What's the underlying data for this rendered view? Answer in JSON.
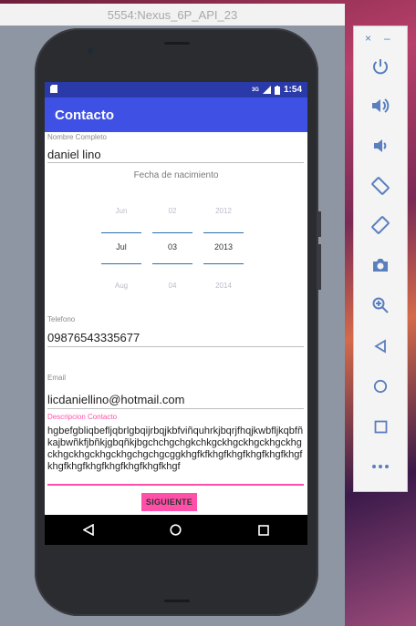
{
  "emulator": {
    "title": "5554:Nexus_6P_API_23"
  },
  "statusbar": {
    "signal": "3G",
    "time": "1:54"
  },
  "appbar": {
    "title": "Contacto"
  },
  "form": {
    "name_label": "Nombre Completo",
    "name_value": "daniel lino",
    "birth_title": "Fecha de nacimiento",
    "picker": {
      "month": {
        "prev": "Jun",
        "selected": "Jul",
        "next": "Aug"
      },
      "day": {
        "prev": "02",
        "selected": "03",
        "next": "04"
      },
      "year": {
        "prev": "2012",
        "selected": "2013",
        "next": "2014"
      }
    },
    "phone_label": "Telefono",
    "phone_value": "09876543335677",
    "email_label": "Email",
    "email_value": "licdaniellino@hotmail.com",
    "desc_label": "Descripcion Contacto",
    "desc_value": "hgbefgbliqbefljqbrlgbqijrbqjkbfviñquhrkjbqrjfhqjkwbfljkqbfñkajbwñkfjbñkjgbqñkjbgchchgchgkchkgckhgckhgckhgckhgckhgckhgckhgckhgchgchgcggkhgfkfkhgfkhgfkhgfkhgfkhgfkhgfkhgfkhgfkhgfkhgfkhgfkhgf",
    "next_button": "SIGUIENTE"
  },
  "toolbar": {
    "minimize": "–",
    "close": "×",
    "tools": [
      "power-icon",
      "volume-up-icon",
      "volume-down-icon",
      "rotate-left-icon",
      "rotate-right-icon",
      "camera-icon",
      "zoom-icon",
      "back-icon",
      "home-icon",
      "overview-icon",
      "more-icon"
    ]
  },
  "colors": {
    "status_bar": "#2a3aa8",
    "app_bar": "#3f51e5",
    "accent": "#ff4fa8",
    "picker_line": "#2a6fb0",
    "toolbar_icon": "#5a7fbf"
  }
}
